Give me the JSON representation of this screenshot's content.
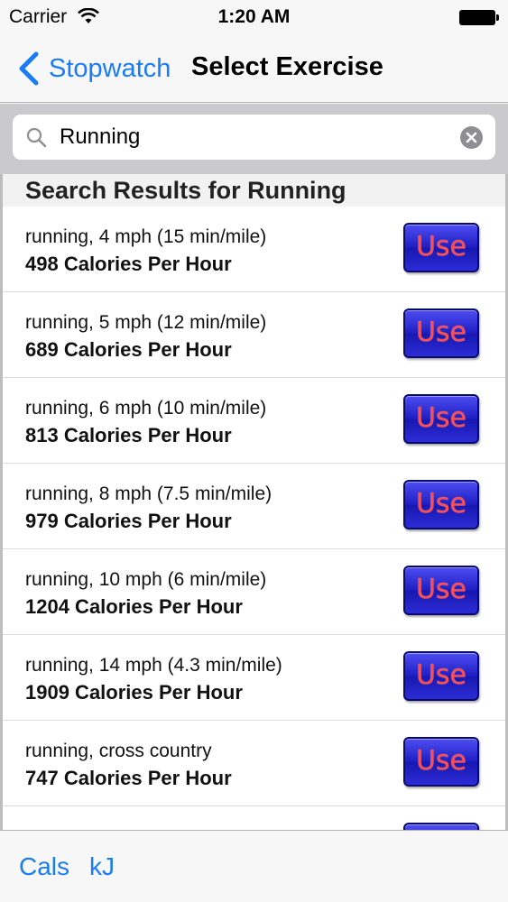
{
  "status_bar": {
    "carrier": "Carrier",
    "time": "1:20 AM"
  },
  "nav": {
    "back_label": "Stopwatch",
    "title": "Select Exercise"
  },
  "search": {
    "value": "Running",
    "placeholder": ""
  },
  "results": {
    "header": "Search Results for Running",
    "use_label": "Use",
    "items": [
      {
        "name": "running, 4 mph (15 min/mile)",
        "calories": "498 Calories Per Hour"
      },
      {
        "name": "running, 5 mph (12 min/mile)",
        "calories": "689 Calories Per Hour"
      },
      {
        "name": "running, 6 mph (10 min/mile)",
        "calories": "813 Calories Per Hour"
      },
      {
        "name": "running, 8 mph (7.5 min/mile)",
        "calories": "979 Calories Per Hour"
      },
      {
        "name": "running, 10 mph (6 min/mile)",
        "calories": "1204 Calories Per Hour"
      },
      {
        "name": "running, 14 mph (4.3 min/mile)",
        "calories": "1909 Calories Per Hour"
      },
      {
        "name": "running, cross country",
        "calories": "747 Calories Per Hour"
      }
    ]
  },
  "toolbar": {
    "cals_label": "Cals",
    "kj_label": "kJ"
  },
  "colors": {
    "accent": "#1a7cf5",
    "use_button": "#2222c8",
    "use_text": "#ff4d4d"
  }
}
